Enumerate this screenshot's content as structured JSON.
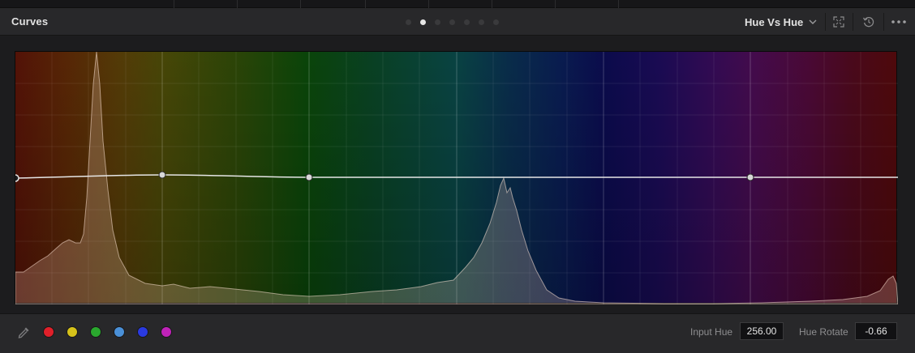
{
  "panel": {
    "title": "Curves",
    "page_dots": [
      {
        "active": false
      },
      {
        "active": true
      },
      {
        "active": false
      },
      {
        "active": false
      },
      {
        "active": false
      },
      {
        "active": false
      },
      {
        "active": false
      }
    ],
    "mode_select": {
      "value": "Hue Vs Hue"
    },
    "header_icons": [
      "expand-icon",
      "reset-icon",
      "more-options-icon"
    ]
  },
  "curve": {
    "control_points_hue_fraction": [
      0.0,
      0.166,
      0.333,
      0.833
    ],
    "histogram_peaks": [
      "orange",
      "cyan-blue"
    ]
  },
  "footer": {
    "picker_icon": "eyedropper-icon",
    "swatches": [
      {
        "name": "red",
        "color": "#e0202a"
      },
      {
        "name": "yellow",
        "color": "#d6c21a"
      },
      {
        "name": "green",
        "color": "#2aa82e"
      },
      {
        "name": "cyan",
        "color": "#4a90d8"
      },
      {
        "name": "blue",
        "color": "#2a3ae0"
      },
      {
        "name": "magenta",
        "color": "#c022b8"
      }
    ],
    "input_hue_label": "Input Hue",
    "input_hue_value": "256.00",
    "hue_rotate_label": "Hue Rotate",
    "hue_rotate_value": "-0.66"
  }
}
